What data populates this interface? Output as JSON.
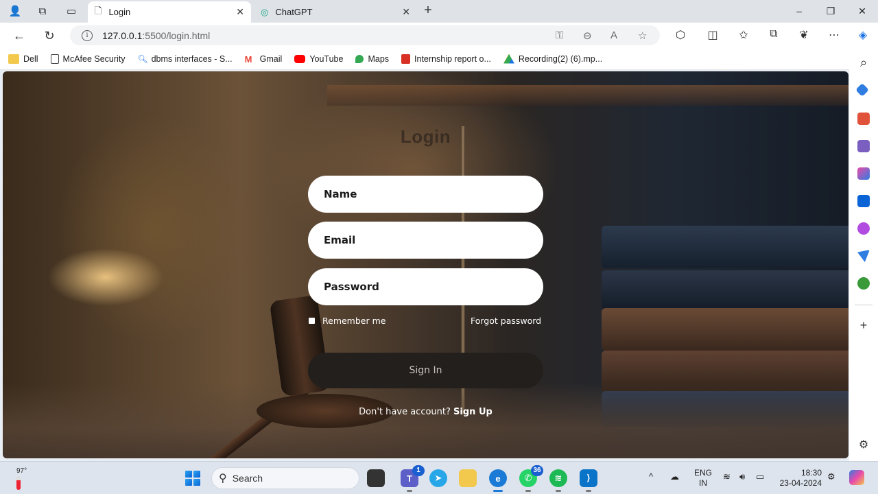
{
  "browser": {
    "tabs": [
      {
        "title": "Login",
        "active": true
      },
      {
        "title": "ChatGPT",
        "active": false
      }
    ],
    "new_tab": "+",
    "url": {
      "host": "127.0.0.1",
      "rest": ":5500/login.html"
    },
    "window_controls": {
      "minimize": "–",
      "restore": "❐",
      "close": "✕"
    }
  },
  "bookmarks": [
    {
      "label": "Dell",
      "color": "#f2c94c"
    },
    {
      "label": "McAfee Security",
      "color": "#ffffff"
    },
    {
      "label": "dbms interfaces - S...",
      "color": "#1a73e8"
    },
    {
      "label": "Gmail",
      "color": "#ea4335"
    },
    {
      "label": "YouTube",
      "color": "#ff0000"
    },
    {
      "label": "Maps",
      "color": "#34a853"
    },
    {
      "label": "Internship report o...",
      "color": "#d93025"
    },
    {
      "label": "Recording(2) (6).mp...",
      "color": "#fbbc04"
    }
  ],
  "page": {
    "title": "Login",
    "name_placeholder": "Name",
    "email_placeholder": "Email",
    "password_placeholder": "Password",
    "remember": "Remember me",
    "forgot": "Forgot password",
    "signin": "Sign In",
    "no_account": "Don't have account?",
    "signup": "Sign Up"
  },
  "taskbar": {
    "weather": "97°",
    "search": "Search",
    "teams_badge": "1",
    "whatsapp_badge": "36",
    "lang_line1": "ENG",
    "lang_line2": "IN",
    "time": "18:30",
    "date": "23-04-2024"
  }
}
